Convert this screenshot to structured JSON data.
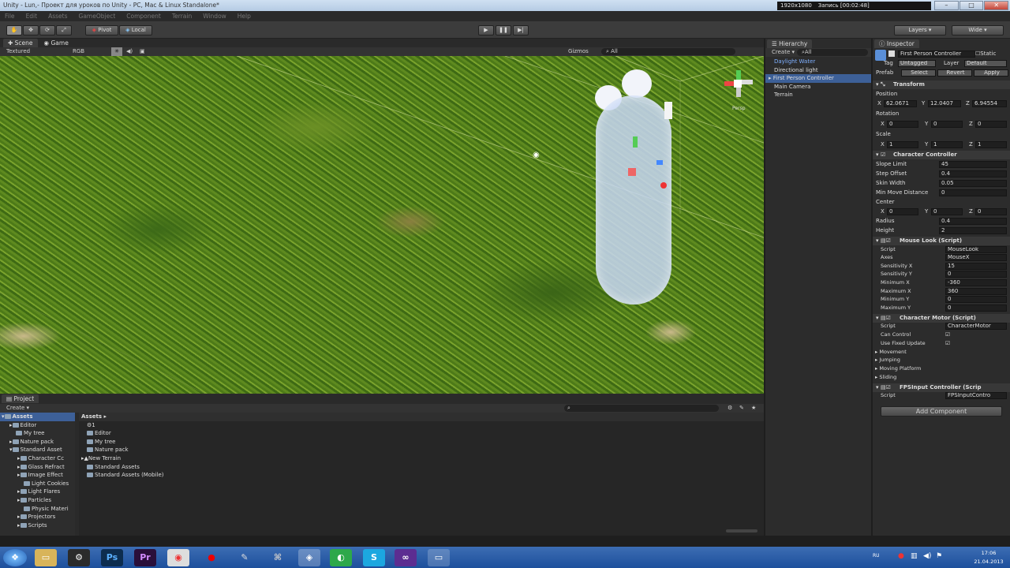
{
  "window": {
    "title": "Unity - Lun,- Проект для уроков по Unity - PC, Mac & Linux Standalone*",
    "recording": {
      "resolution": "1920x1080",
      "label": "Запись [00:02:48]"
    }
  },
  "menu": [
    "File",
    "Edit",
    "Assets",
    "GameObject",
    "Component",
    "Terrain",
    "Window",
    "Help"
  ],
  "toolbar": {
    "pivot": "Pivot",
    "local": "Local",
    "layers": "Layers",
    "layout": "Wide"
  },
  "scene": {
    "tab_scene": "Scene",
    "tab_game": "Game",
    "render_mode": "Textured",
    "color_mode": "RGB",
    "gizmos": "Gizmos",
    "search_all": "All",
    "persp": "Persp"
  },
  "hierarchy": {
    "title": "Hierarchy",
    "create": "Create",
    "search": "All",
    "items": [
      "Daylight Water",
      "Directional light",
      "First Person Controller",
      "Main Camera",
      "Terrain"
    ]
  },
  "inspector": {
    "title": "Inspector",
    "object_name": "First Person Controller",
    "static": "Static",
    "tag_label": "Tag",
    "tag": "Untagged",
    "layer_label": "Layer",
    "layer": "Default",
    "prefab_label": "Prefab",
    "select": "Select",
    "revert": "Revert",
    "apply": "Apply",
    "transform": {
      "title": "Transform",
      "position": "Position",
      "px": "62.0671",
      "py": "12.0407",
      "pz": "6.94554",
      "rotation": "Rotation",
      "rx": "0",
      "ry": "0",
      "rz": "0",
      "scale": "Scale",
      "sx": "1",
      "sy": "1",
      "sz": "1"
    },
    "cc": {
      "title": "Character Controller",
      "slope_label": "Slope Limit",
      "slope": "45",
      "step_label": "Step Offset",
      "step": "0.4",
      "skin_label": "Skin Width",
      "skin": "0.05",
      "minmove_label": "Min Move Distance",
      "minmove": "0",
      "center": "Center",
      "cx": "0",
      "cy": "0",
      "cz": "0",
      "radius_label": "Radius",
      "radius": "0.4",
      "height_label": "Height",
      "height": "2"
    },
    "mouselook": {
      "title": "Mouse Look (Script)",
      "script_label": "Script",
      "script": "MouseLook",
      "axes_label": "Axes",
      "axes": "MouseX",
      "sensx_label": "Sensitivity X",
      "sensx": "15",
      "sensy_label": "Sensitivity Y",
      "sensy": "0",
      "minx_label": "Minimum X",
      "minx": "-360",
      "maxx_label": "Maximum X",
      "maxx": "360",
      "miny_label": "Minimum Y",
      "miny": "0",
      "maxy_label": "Maximum Y",
      "maxy": "0"
    },
    "motor": {
      "title": "Character Motor (Script)",
      "script_label": "Script",
      "script": "CharacterMotor",
      "can_control": "Can Control",
      "fixed_update": "Use Fixed Update",
      "movement": "Movement",
      "jumping": "Jumping",
      "moving_platform": "Moving Platform",
      "sliding": "Sliding"
    },
    "fps": {
      "title": "FPSInput Controller (Scrip",
      "script_label": "Script",
      "script": "FPSInputContro"
    },
    "add_component": "Add Component"
  },
  "project": {
    "title": "Project",
    "create": "Create",
    "breadcrumb": "Assets",
    "tree": [
      "Assets",
      "Editor",
      "My tree",
      "Nature pack",
      "Standard Asset",
      "Character Cc",
      "Glass Refract",
      "Image Effect",
      "Light Cookies",
      "Light Flares",
      "Particles",
      "Physic Materi",
      "Projectors",
      "Scripts"
    ],
    "list": [
      "1",
      "Editor",
      "My tree",
      "Nature pack",
      "New Terrain",
      "Standard Assets",
      "Standard Assets (Mobile)"
    ]
  },
  "taskbar": {
    "lang": "RU",
    "time": "17:06",
    "date": "21.04.2013",
    "apps": [
      "Ps",
      "Pr"
    ]
  }
}
